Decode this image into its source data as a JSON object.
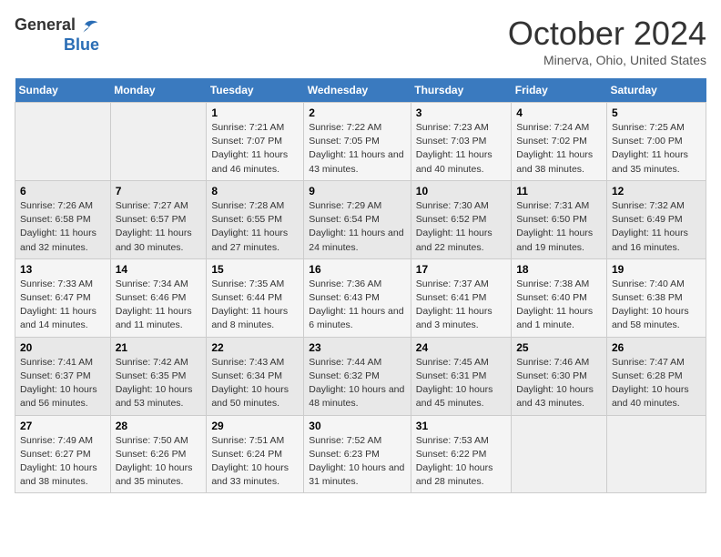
{
  "header": {
    "logo_general": "General",
    "logo_blue": "Blue",
    "title": "October 2024",
    "location": "Minerva, Ohio, United States"
  },
  "weekdays": [
    "Sunday",
    "Monday",
    "Tuesday",
    "Wednesday",
    "Thursday",
    "Friday",
    "Saturday"
  ],
  "weeks": [
    [
      null,
      null,
      {
        "day": 1,
        "sunrise": "7:21 AM",
        "sunset": "7:07 PM",
        "daylight": "11 hours and 46 minutes."
      },
      {
        "day": 2,
        "sunrise": "7:22 AM",
        "sunset": "7:05 PM",
        "daylight": "11 hours and 43 minutes."
      },
      {
        "day": 3,
        "sunrise": "7:23 AM",
        "sunset": "7:03 PM",
        "daylight": "11 hours and 40 minutes."
      },
      {
        "day": 4,
        "sunrise": "7:24 AM",
        "sunset": "7:02 PM",
        "daylight": "11 hours and 38 minutes."
      },
      {
        "day": 5,
        "sunrise": "7:25 AM",
        "sunset": "7:00 PM",
        "daylight": "11 hours and 35 minutes."
      }
    ],
    [
      {
        "day": 6,
        "sunrise": "7:26 AM",
        "sunset": "6:58 PM",
        "daylight": "11 hours and 32 minutes."
      },
      {
        "day": 7,
        "sunrise": "7:27 AM",
        "sunset": "6:57 PM",
        "daylight": "11 hours and 30 minutes."
      },
      {
        "day": 8,
        "sunrise": "7:28 AM",
        "sunset": "6:55 PM",
        "daylight": "11 hours and 27 minutes."
      },
      {
        "day": 9,
        "sunrise": "7:29 AM",
        "sunset": "6:54 PM",
        "daylight": "11 hours and 24 minutes."
      },
      {
        "day": 10,
        "sunrise": "7:30 AM",
        "sunset": "6:52 PM",
        "daylight": "11 hours and 22 minutes."
      },
      {
        "day": 11,
        "sunrise": "7:31 AM",
        "sunset": "6:50 PM",
        "daylight": "11 hours and 19 minutes."
      },
      {
        "day": 12,
        "sunrise": "7:32 AM",
        "sunset": "6:49 PM",
        "daylight": "11 hours and 16 minutes."
      }
    ],
    [
      {
        "day": 13,
        "sunrise": "7:33 AM",
        "sunset": "6:47 PM",
        "daylight": "11 hours and 14 minutes."
      },
      {
        "day": 14,
        "sunrise": "7:34 AM",
        "sunset": "6:46 PM",
        "daylight": "11 hours and 11 minutes."
      },
      {
        "day": 15,
        "sunrise": "7:35 AM",
        "sunset": "6:44 PM",
        "daylight": "11 hours and 8 minutes."
      },
      {
        "day": 16,
        "sunrise": "7:36 AM",
        "sunset": "6:43 PM",
        "daylight": "11 hours and 6 minutes."
      },
      {
        "day": 17,
        "sunrise": "7:37 AM",
        "sunset": "6:41 PM",
        "daylight": "11 hours and 3 minutes."
      },
      {
        "day": 18,
        "sunrise": "7:38 AM",
        "sunset": "6:40 PM",
        "daylight": "11 hours and 1 minute."
      },
      {
        "day": 19,
        "sunrise": "7:40 AM",
        "sunset": "6:38 PM",
        "daylight": "10 hours and 58 minutes."
      }
    ],
    [
      {
        "day": 20,
        "sunrise": "7:41 AM",
        "sunset": "6:37 PM",
        "daylight": "10 hours and 56 minutes."
      },
      {
        "day": 21,
        "sunrise": "7:42 AM",
        "sunset": "6:35 PM",
        "daylight": "10 hours and 53 minutes."
      },
      {
        "day": 22,
        "sunrise": "7:43 AM",
        "sunset": "6:34 PM",
        "daylight": "10 hours and 50 minutes."
      },
      {
        "day": 23,
        "sunrise": "7:44 AM",
        "sunset": "6:32 PM",
        "daylight": "10 hours and 48 minutes."
      },
      {
        "day": 24,
        "sunrise": "7:45 AM",
        "sunset": "6:31 PM",
        "daylight": "10 hours and 45 minutes."
      },
      {
        "day": 25,
        "sunrise": "7:46 AM",
        "sunset": "6:30 PM",
        "daylight": "10 hours and 43 minutes."
      },
      {
        "day": 26,
        "sunrise": "7:47 AM",
        "sunset": "6:28 PM",
        "daylight": "10 hours and 40 minutes."
      }
    ],
    [
      {
        "day": 27,
        "sunrise": "7:49 AM",
        "sunset": "6:27 PM",
        "daylight": "10 hours and 38 minutes."
      },
      {
        "day": 28,
        "sunrise": "7:50 AM",
        "sunset": "6:26 PM",
        "daylight": "10 hours and 35 minutes."
      },
      {
        "day": 29,
        "sunrise": "7:51 AM",
        "sunset": "6:24 PM",
        "daylight": "10 hours and 33 minutes."
      },
      {
        "day": 30,
        "sunrise": "7:52 AM",
        "sunset": "6:23 PM",
        "daylight": "10 hours and 31 minutes."
      },
      {
        "day": 31,
        "sunrise": "7:53 AM",
        "sunset": "6:22 PM",
        "daylight": "10 hours and 28 minutes."
      },
      null,
      null
    ]
  ]
}
